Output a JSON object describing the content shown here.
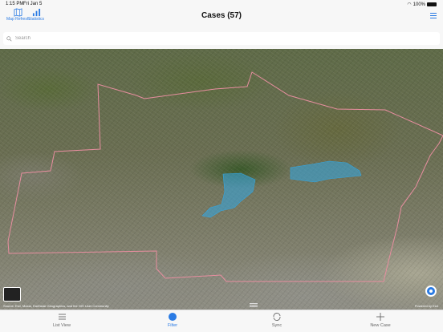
{
  "status": {
    "time": "1:15 PM",
    "date": "Fri Jan 5",
    "battery": "100%"
  },
  "nav": {
    "title": "Cases (57)",
    "left_buttons": [
      {
        "label": "Map Refresh",
        "icon": "map-refresh-icon"
      },
      {
        "label": "Statistics",
        "icon": "statistics-icon"
      }
    ],
    "right_icon": "menu-icon"
  },
  "search": {
    "placeholder": "Search",
    "value": ""
  },
  "map": {
    "attribution": "Source: Esri, Maxar, Earthstar Geographics, and the GIS User Community",
    "powered_by": "Powered by Esri",
    "boundary_color": "#e88ea0",
    "highlight_color": "#33a7e3"
  },
  "tabs": [
    {
      "label": "List View",
      "icon": "list-icon",
      "active": false
    },
    {
      "label": "Filter",
      "icon": "filter-icon",
      "active": true
    },
    {
      "label": "Sync",
      "icon": "sync-icon",
      "active": false
    },
    {
      "label": "New Case",
      "icon": "plus-icon",
      "active": false
    }
  ],
  "colors": {
    "accent": "#2a7be4"
  }
}
